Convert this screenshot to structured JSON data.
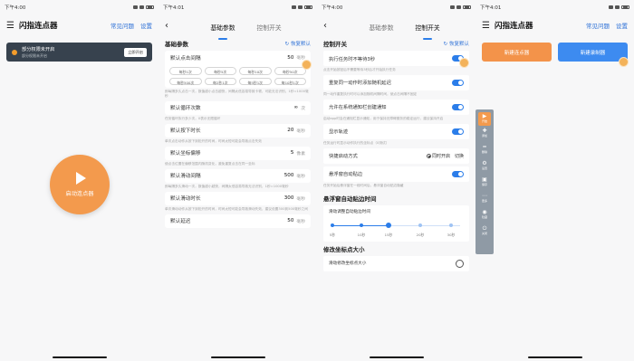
{
  "status": {
    "s1": "下午4:00",
    "s2": "下午4:01",
    "s3": "下午4:00",
    "s4": "下午4:01",
    "battery": "82"
  },
  "home": {
    "title": "闪指连点器",
    "link1": "常见问题",
    "link2": "设置",
    "banner_title": "部分权限未开启",
    "banner_sub": "部分权限未开启",
    "banner_btn": "立即开启",
    "start_label": "启动连点器"
  },
  "params": {
    "tab1": "基础参数",
    "tab2": "控制开关",
    "section": "基础参数",
    "reset": "恢复默认",
    "interval_label": "默认点击间隔",
    "interval_value": "50",
    "unit_ms": "毫秒",
    "chips": [
      "每秒1次",
      "每秒5次",
      "每秒10次",
      "每秒50次",
      "每秒500次",
      "每2秒1次",
      "每5秒1次",
      "每10秒1次"
    ],
    "interval_note": "即每隔多久点击一次，数值越小点击越快，间隔太低容易导致卡顿，可能无法识别，1秒=1000毫秒",
    "loop_label": "默认循环次数",
    "loop_value": "∞",
    "unit_times": "次",
    "loop_note": "任务循环执行多少次，0表示无限循环",
    "press_label": "默认按下时长",
    "press_value": "20",
    "press_note": "单次点击动作从按下到松开的时间，时间太短可能会导致点击失效",
    "offset_label": "默认坐标偏移",
    "offset_value": "5",
    "unit_px": "像素",
    "offset_note": "使点击位置在偏移范围内随机变化，避免重复点击在同一坐标",
    "swipe_interval_label": "默认滑动间隔",
    "swipe_interval_value": "500",
    "swipe_interval_note": "即每隔多久滑动一次，数值越小越快，间隔太低容易导致无法识别，1秒=1000毫秒",
    "swipe_dur_label": "默认滑动时长",
    "swipe_dur_value": "300",
    "swipe_dur_note": "单次滑动动作从按下到松开的时间，时间太短可能会导致滑动失效，建议设置300到500毫秒之间",
    "delay_label": "默认延迟",
    "delay_value": "50"
  },
  "switches": {
    "tab1": "基础参数",
    "tab2": "控制开关",
    "section": "控制开关",
    "reset": "恢复默认",
    "row1": "执行任务时不等待3秒",
    "note1": "点击开始按钮后不需要等待3秒后才开始执行任务",
    "row2": "重复同一动作时添加随机延迟",
    "note2": "同一动作重复执行时可以添加随机间隔时间，使点击间隔不固定",
    "row3": "允许在系统通知栏创建通知",
    "note3": "启动app时会在通知栏显示通知，用于保持无障碍服务的稳定运行，建议保持开启",
    "row4": "显示轨迹",
    "note4": "任务运行时显示动作执行的坐标点（0测试）",
    "row5": "快捷启动方式",
    "opt1": "同时开启",
    "opt2": "切换",
    "row6": "悬浮窗自动贴边",
    "note6": "任务开始后悬浮窗在一段时间后，悬浮窗自动贴边隐藏",
    "section2": "悬浮窗自动贴边时间",
    "slider_label": "滑动调整自动贴边时间",
    "ticks": [
      "5秒",
      "10秒",
      "15秒",
      "20秒",
      "30秒"
    ],
    "slider_value_index": 2,
    "section3": "修改坐标点大小",
    "size_label": "滑动修改坐标点大小"
  },
  "create": {
    "btn1": "新建连点器",
    "btn2": "新建录制器",
    "float": [
      "开始",
      "添加",
      "删除",
      "设置",
      "保存",
      "更多",
      "隐藏",
      "关闭"
    ]
  },
  "colors": {
    "accent": "#2b7de9",
    "orange": "#f39a4d"
  }
}
